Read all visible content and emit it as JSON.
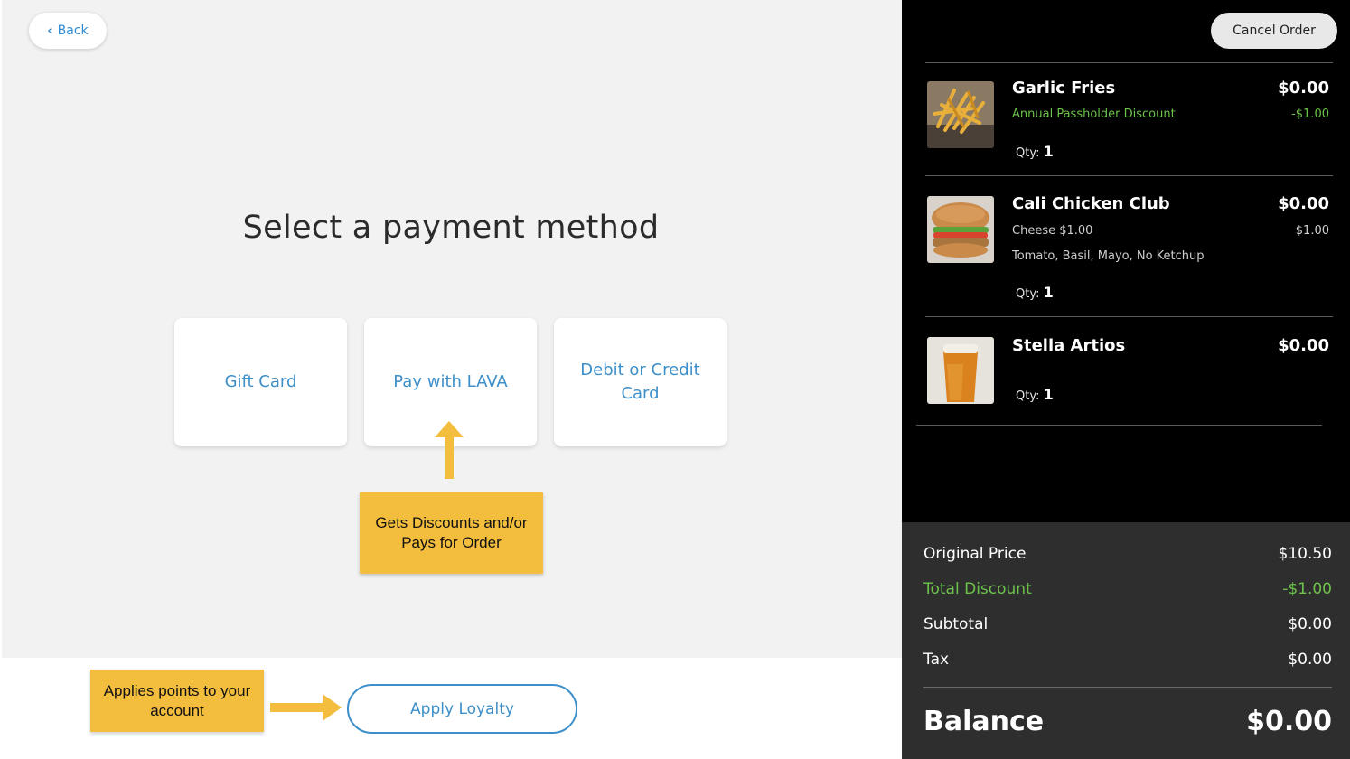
{
  "nav": {
    "back_label": "Back"
  },
  "page": {
    "title": "Select a payment method"
  },
  "payment_methods": [
    {
      "label": "Gift Card"
    },
    {
      "label": "Pay with LAVA"
    },
    {
      "label": "Debit or Credit Card"
    }
  ],
  "annotations": {
    "lava_note": "Gets Discounts and/or Pays for Order",
    "loyalty_note": "Applies points to your account"
  },
  "loyalty": {
    "button_label": "Apply Loyalty"
  },
  "order": {
    "cancel_label": "Cancel Order",
    "qty_label": "Qty:",
    "items": [
      {
        "name": "Garlic Fries",
        "price": "$0.00",
        "modifiers": [
          {
            "label": "Annual Passholder Discount",
            "amount": "-$1.00",
            "discount": true
          }
        ],
        "qty": "1"
      },
      {
        "name": "Cali Chicken Club",
        "price": "$0.00",
        "modifiers": [
          {
            "label": "Cheese $1.00",
            "amount": "$1.00"
          },
          {
            "label": "Tomato, Basil,  Mayo, No Ketchup",
            "amount": ""
          }
        ],
        "qty": "1"
      },
      {
        "name": "Stella Artios",
        "price": "$0.00",
        "modifiers": [],
        "qty": "1"
      }
    ]
  },
  "summary": {
    "original_price_label": "Original Price",
    "original_price": "$10.50",
    "total_discount_label": "Total Discount",
    "total_discount": "-$1.00",
    "subtotal_label": "Subtotal",
    "subtotal": "$0.00",
    "tax_label": "Tax",
    "tax": "$0.00",
    "balance_label": "Balance",
    "balance": "$0.00"
  },
  "colors": {
    "accent": "#3d8fc9",
    "note": "#f3bd3e",
    "discount": "#6cc24a"
  }
}
